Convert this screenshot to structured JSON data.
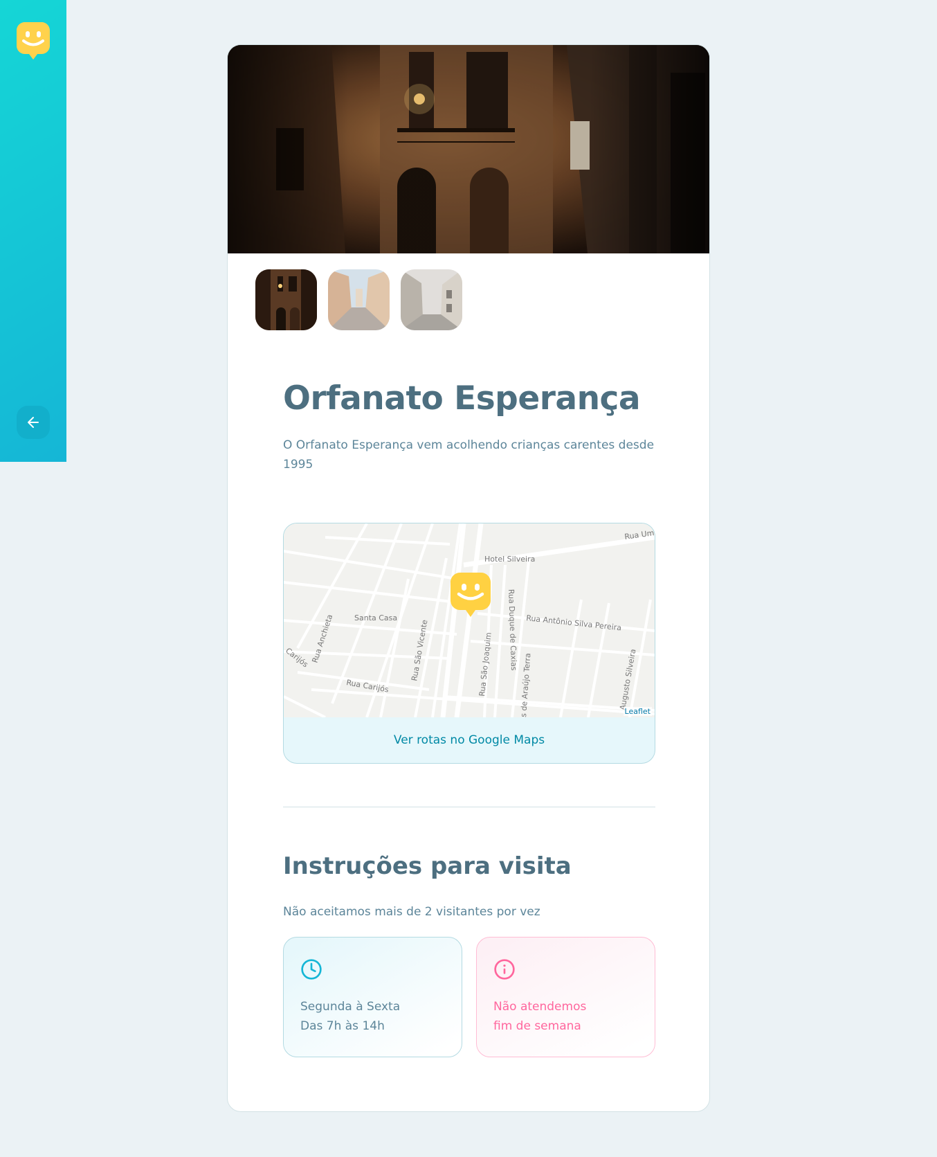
{
  "sidebar": {
    "logo_icon": "happy-face-logo",
    "back_icon": "arrow-left-icon",
    "colors": {
      "gradient_start": "#15d6d6",
      "gradient_end": "#15b6d6"
    }
  },
  "orphanage": {
    "name": "Orfanato Esperança",
    "about": "O Orfanato Esperança vem acolhendo crianças carentes desde 1995",
    "images": [
      {
        "alt": "Orfanato Esperança",
        "active": true
      },
      {
        "alt": "Orfanato Esperança",
        "active": false
      },
      {
        "alt": "Orfanato Esperança",
        "active": false
      }
    ]
  },
  "map": {
    "labels": {
      "hotel": "Hotel Silveira",
      "santa_casa": "Santa Casa",
      "rua_um": "Rua Um",
      "rua_antonio": "Rua Antônio Silva Pereira",
      "rua_anchieta": "Rua Anchieta",
      "rua_sao_vicente": "Rua São Vicente",
      "rua_duque": "Rua Duque de Caxias",
      "rua_sao_joaquim": "Rua São Joaquim",
      "rua_araujo": "s de Araújo Terra",
      "rua_augusto": "Augusto Silveira",
      "rua_carijos": "Rua Carijós",
      "rua_cut": "Carijós"
    },
    "attribution": "Leaflet",
    "routes_link": "Ver rotas no Google Maps",
    "marker_icon": "happy-face-map-marker"
  },
  "visit": {
    "section_title": "Instruções para visita",
    "instructions": "Não aceitamos mais de 2 visitantes por vez",
    "hours": {
      "icon": "clock-icon",
      "line1": "Segunda à Sexta",
      "line2": "Das 7h às 14h"
    },
    "weekends": {
      "icon": "info-icon",
      "line1": "Não atendemos",
      "line2": "fim de semana"
    }
  },
  "colors": {
    "title": "#4d6f80",
    "text": "#5c8599",
    "accent_blue": "#15c3d6",
    "accent_pink": "#ff669d",
    "logo_yellow": "#ffd666"
  }
}
